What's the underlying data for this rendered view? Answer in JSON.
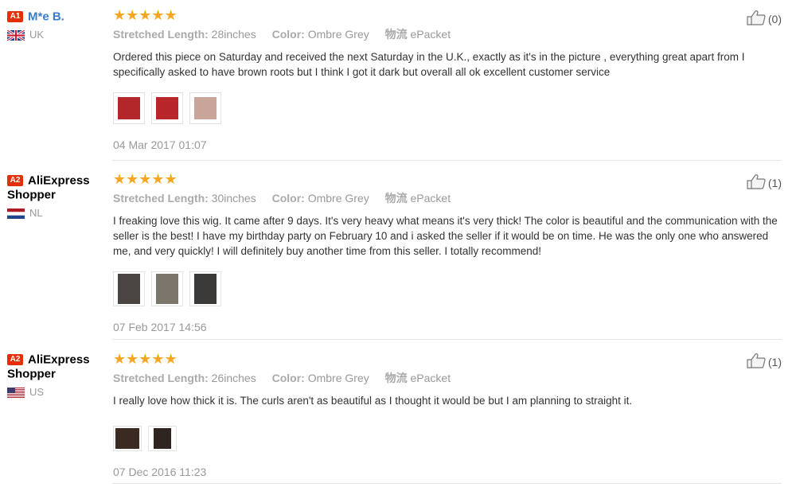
{
  "reviews": [
    {
      "level": "A1",
      "level_color": "#e62e04",
      "name": "M*e B.",
      "country": "UK",
      "rating": 5,
      "stars": "★★★★★",
      "props": [
        {
          "key": "Stretched Length:",
          "value": "28inches"
        },
        {
          "key": "Color:",
          "value": "Ombre Grey"
        },
        {
          "key": "物流",
          "value": "ePacket"
        }
      ],
      "text": "Ordered this piece on Saturday and received the next Saturday in the U.K., exactly as it's in the picture , everything great apart from I specifically asked to have brown roots but I think I got it dark but overall all ok excellent customer service",
      "photos": [
        {
          "color": "#b3262a"
        },
        {
          "color": "#b8262a"
        },
        {
          "color": "#c9a49a"
        }
      ],
      "date": "04 Mar 2017 01:07",
      "likes": "(0)"
    },
    {
      "level": "A2",
      "level_color": "#e62e04",
      "name": "AliExpress Shopper",
      "country": "NL",
      "rating": 5,
      "stars": "★★★★★",
      "props": [
        {
          "key": "Stretched Length:",
          "value": "30inches"
        },
        {
          "key": "Color:",
          "value": "Ombre Grey"
        },
        {
          "key": "物流",
          "value": "ePacket"
        }
      ],
      "text": "I freaking love this wig. It came after 9 days. It's very heavy what means it's very thick! The color is beautiful and the communication with the seller is the best! I have my birthday party on February 10 and i asked the seller if it would be on time. He was the only one who answered me, and very quickly! I will definitely buy another time from this seller. I totally recommend!",
      "photos": [
        {
          "color": "#4a4440"
        },
        {
          "color": "#7b756c"
        },
        {
          "color": "#3c3a38"
        }
      ],
      "date": "07 Feb 2017 14:56",
      "likes": "(1)"
    },
    {
      "level": "A2",
      "level_color": "#e62e04",
      "name": "AliExpress Shopper",
      "country": "US",
      "rating": 5,
      "stars": "★★★★★",
      "props": [
        {
          "key": "Stretched Length:",
          "value": "26inches"
        },
        {
          "key": "Color:",
          "value": "Ombre Grey"
        },
        {
          "key": "物流",
          "value": "ePacket"
        }
      ],
      "text": "I really love how thick it is. The curls aren't as beautiful as I thought it would be but I am planning to straight it.",
      "photos": [
        {
          "color": "#3b2a22"
        },
        {
          "color": "#2e2420"
        }
      ],
      "date": "07 Dec 2016 11:23",
      "likes": "(1)"
    }
  ]
}
